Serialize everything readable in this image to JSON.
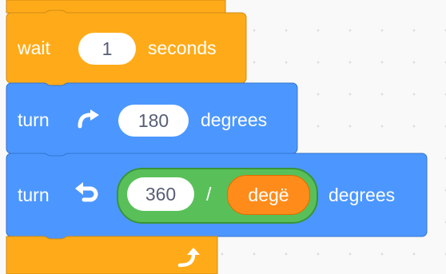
{
  "blocks": {
    "wait": {
      "label": "wait",
      "value": "1",
      "unit": "seconds",
      "color": "#ffab19"
    },
    "turn_right": {
      "label": "turn",
      "icon": "rotate-clockwise-icon",
      "value": "180",
      "unit": "degrees",
      "color": "#4c97ff"
    },
    "turn_left": {
      "label": "turn",
      "icon": "rotate-counterclockwise-icon",
      "divide": {
        "left": "360",
        "operator": "/",
        "right_reporter": "degë",
        "color": "#59c059"
      },
      "unit": "degrees",
      "color": "#4c97ff"
    },
    "loop_end": {
      "icon": "loop-arrow-icon",
      "color": "#ffab19"
    }
  }
}
